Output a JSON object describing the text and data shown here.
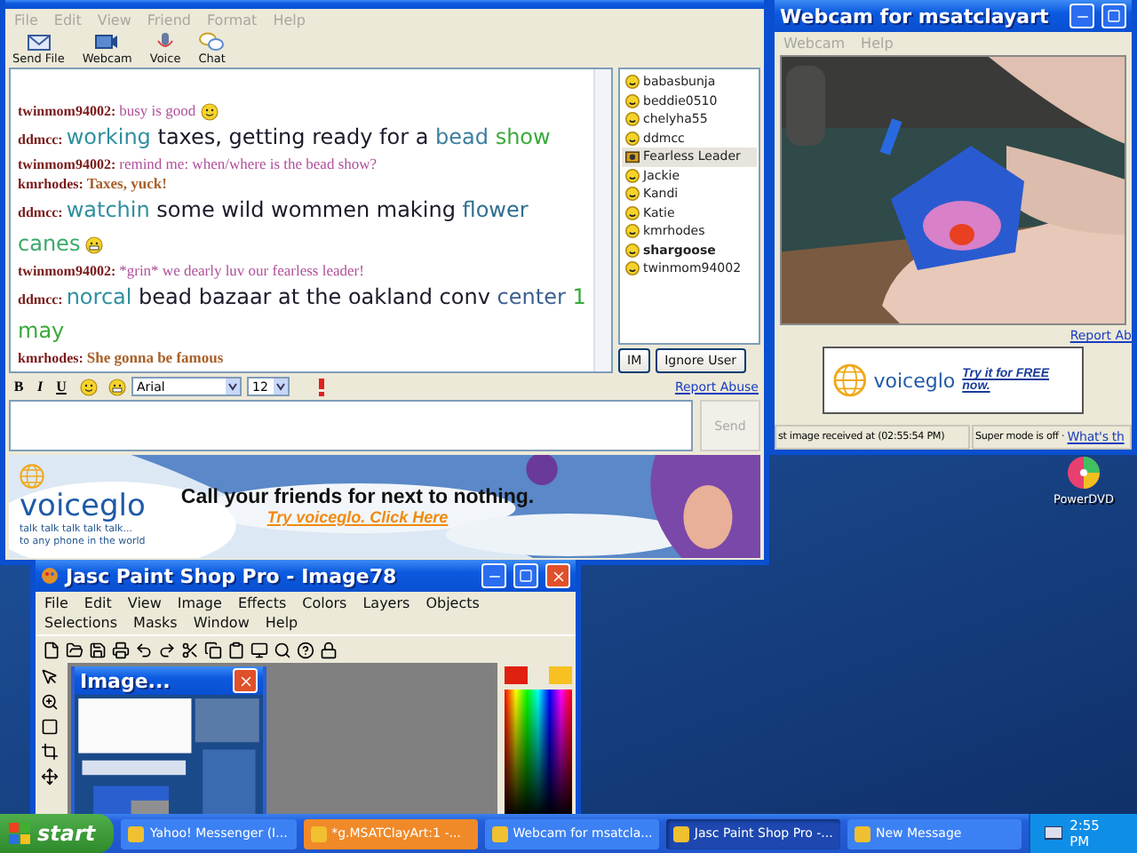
{
  "chat_window": {
    "menu": [
      "File",
      "Edit",
      "View",
      "Friend",
      "Format",
      "Help"
    ],
    "toolbar": [
      {
        "label": "Send File",
        "kind": "file"
      },
      {
        "label": "Webcam",
        "kind": "webcam"
      },
      {
        "label": "Voice",
        "kind": "voice"
      },
      {
        "label": "Chat",
        "kind": "chat"
      }
    ],
    "messages": [
      {
        "user": "twinmom94002:",
        "kind": "plain",
        "segments": [
          {
            "text": "busy is good",
            "color": "#b0509a"
          }
        ],
        "emoticon": {
          "kind": "smile"
        }
      },
      {
        "user": "ddmcc:",
        "kind": "comic",
        "segments": [
          {
            "text": "working",
            "color": "#2f8f9f"
          },
          {
            "text": "taxes, getting ready for a",
            "color": "#1a1a2a"
          },
          {
            "text": "bead",
            "color": "#3a7fa0"
          },
          {
            "text": "show",
            "color": "#3aaa3a"
          }
        ]
      },
      {
        "user": "twinmom94002:",
        "kind": "plain",
        "segments": [
          {
            "text": "remind me: when/where is the bead show?",
            "color": "#b0509a"
          }
        ]
      },
      {
        "user": "kmrhodes:",
        "kind": "bold",
        "segments": [
          {
            "text": "Taxes, yuck!",
            "color": "#a8602a"
          }
        ]
      },
      {
        "user": "ddmcc:",
        "kind": "comic",
        "segments": [
          {
            "text": "watchin",
            "color": "#2f8f9f"
          },
          {
            "text": "some wild wommen making",
            "color": "#1a1a2a"
          },
          {
            "text": "flower",
            "color": "#2f6f8f"
          },
          {
            "text": "canes",
            "color": "#3aaa6a"
          }
        ],
        "emoticon": {
          "kind": "grin"
        }
      },
      {
        "user": "twinmom94002:",
        "kind": "plain",
        "segments": [
          {
            "text": "*grin* we dearly luv our fearless leader!",
            "color": "#b0509a"
          }
        ]
      },
      {
        "user": "ddmcc:",
        "kind": "comic",
        "segments": [
          {
            "text": "norcal",
            "color": "#2f8f9f"
          },
          {
            "text": "bead bazaar at the oakland conv",
            "color": "#1a1a2a"
          },
          {
            "text": "center",
            "color": "#3a5f8f"
          },
          {
            "text": "1 may",
            "color": "#3aaa3a"
          }
        ]
      },
      {
        "user": "kmrhodes:",
        "kind": "bold",
        "segments": [
          {
            "text": "She gonna be famous",
            "color": "#a8602a"
          }
        ]
      }
    ],
    "users": [
      {
        "name": "babasbunja",
        "kind": "smiley",
        "selected": false,
        "bold": false
      },
      {
        "name": "beddie0510",
        "kind": "smiley",
        "selected": false,
        "bold": false
      },
      {
        "name": "chelyha55",
        "kind": "smiley",
        "selected": false,
        "bold": false
      },
      {
        "name": "ddmcc",
        "kind": "smiley",
        "selected": false,
        "bold": false
      },
      {
        "name": "Fearless Leader",
        "kind": "webcam",
        "selected": true,
        "bold": false
      },
      {
        "name": "Jackie",
        "kind": "smiley",
        "selected": false,
        "bold": false
      },
      {
        "name": "Kandi",
        "kind": "smiley",
        "selected": false,
        "bold": false
      },
      {
        "name": "Katie",
        "kind": "smiley",
        "selected": false,
        "bold": false
      },
      {
        "name": "kmrhodes",
        "kind": "smiley",
        "selected": false,
        "bold": false
      },
      {
        "name": "shargoose",
        "kind": "smiley",
        "selected": false,
        "bold": true
      },
      {
        "name": "twinmom94002",
        "kind": "smiley",
        "selected": false,
        "bold": false
      }
    ],
    "user_buttons": [
      "IM",
      "Ignore User"
    ],
    "format_bar": {
      "bold": "B",
      "italic": "I",
      "underline": "U",
      "font": "Arial",
      "size": "12"
    },
    "report_abuse": "Report Abuse",
    "send": "Send",
    "ad": {
      "brand": "voiceglo",
      "tagline_1": "talk talk talk talk talk...",
      "tagline_2": "to any phone in the world",
      "headline": "Call your friends for next to nothing.",
      "cta": "Try voiceglo. Click Here"
    }
  },
  "webcam_window": {
    "title": "Webcam for msatclayart",
    "menu": [
      "Webcam",
      "Help"
    ],
    "report_abuse": "Report Ab",
    "ad": {
      "brand": "voiceglo",
      "cta": "Try it for FREE now."
    },
    "status": "st image received at (02:55:54 PM)",
    "mode": "Super mode is off ·",
    "mode_link": "What's th"
  },
  "desktop_icons": [
    {
      "label": "PowerDVD"
    }
  ],
  "psp_window": {
    "title": "Jasc Paint Shop Pro - Image78",
    "menu": [
      "File",
      "Edit",
      "View",
      "Image",
      "Effects",
      "Colors",
      "Layers",
      "Objects",
      "Selections",
      "Masks",
      "Window",
      "Help"
    ],
    "child_title": "Image..."
  },
  "taskbar": {
    "start": "start",
    "clock": "2:55 PM",
    "tasks": [
      {
        "label": "Yahoo! Messenger (I...",
        "selected": false,
        "flashing": false
      },
      {
        "label": "*g.MSATClayArt:1 -...",
        "selected": false,
        "flashing": true
      },
      {
        "label": "Webcam for msatcla...",
        "selected": false,
        "flashing": false
      },
      {
        "label": "Jasc Paint Shop Pro -...",
        "selected": true,
        "flashing": false
      },
      {
        "label": "New Message",
        "selected": false,
        "flashing": false
      }
    ]
  }
}
